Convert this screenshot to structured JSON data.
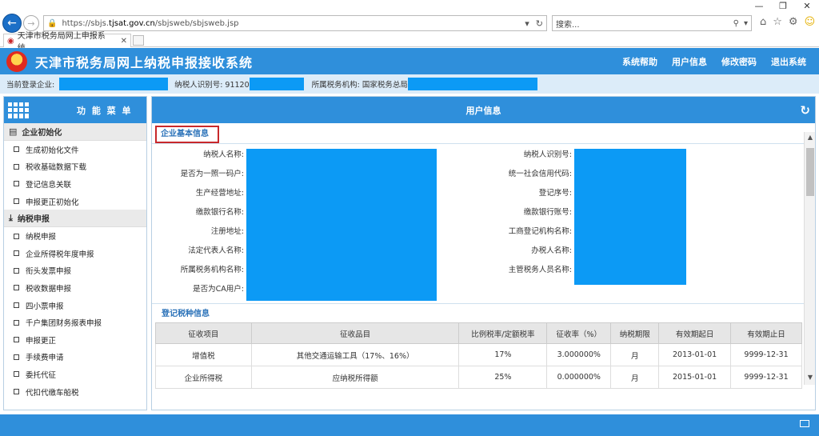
{
  "browser": {
    "url_prefix": "https://sbjs.",
    "url_domain": "tjsat.gov.cn",
    "url_path": "/sbjsweb/sbjsweb.jsp",
    "search_placeholder": "搜索...",
    "tab_title": "天津市税务局网上申报系统...",
    "win_min": "—",
    "win_restore": "❐",
    "win_close": "✕",
    "icon_home": "⌂",
    "icon_star": "☆",
    "icon_gear": "⚙",
    "icon_smile": "☺"
  },
  "app": {
    "title": "天津市税务局网上纳税申报接收系统",
    "links": [
      "系统帮助",
      "用户信息",
      "修改密码",
      "退出系统"
    ]
  },
  "info_bar": {
    "company_label": "当前登录企业:",
    "taxpayer_id_label": "纳税人识别号: 91120",
    "tax_office_label": "所属税务机构: 国家税务总局"
  },
  "sidebar": {
    "title": "功 能 菜 单",
    "groups": [
      {
        "label": "企业初始化",
        "items": [
          "生成初始化文件",
          "税收基础数据下载",
          "登记信息关联",
          "申报更正初始化"
        ]
      },
      {
        "label": "纳税申报",
        "items": [
          "纳税申报",
          "企业所得税年度申报",
          "衔头发票申报",
          "税收数据申报",
          "四小票申报",
          "千户集团财务报表申报",
          "申报更正",
          "手续费申请",
          "委托代征",
          "代扣代缴车船税"
        ]
      }
    ]
  },
  "main": {
    "title": "用户信息",
    "section_basic": "企业基本信息",
    "left_fields": [
      "纳税人名称:",
      "是否为一照一码户:",
      "生产经营地址:",
      "缴款银行名称:",
      "注册地址:",
      "法定代表人名称:",
      "所属税务机构名称:",
      "是否为CA用户:"
    ],
    "right_fields": [
      "纳税人识别号:",
      "统一社会信用代码:",
      "登记序号:",
      "缴款银行账号:",
      "工商登记机构名称:",
      "办税人名称:",
      "主管税务人员名称:"
    ],
    "section_tax": "登记税种信息",
    "table": {
      "headers": [
        "征收项目",
        "征收品目",
        "比例税率/定额税率",
        "征收率（%）",
        "纳税期限",
        "有效期起日",
        "有效期止日"
      ],
      "rows": [
        [
          "增值税",
          "其他交通运输工具（17%、16%）",
          "17%",
          "3.000000%",
          "月",
          "2013-01-01",
          "9999-12-31"
        ],
        [
          "企业所得税",
          "应纳税所得额",
          "25%",
          "0.000000%",
          "月",
          "2015-01-01",
          "9999-12-31"
        ]
      ]
    }
  },
  "colors": {
    "header_blue": "#2f8fdb",
    "mask_blue": "#0c9af5",
    "highlight_red": "#c8282b",
    "section_text": "#2c73b9"
  }
}
